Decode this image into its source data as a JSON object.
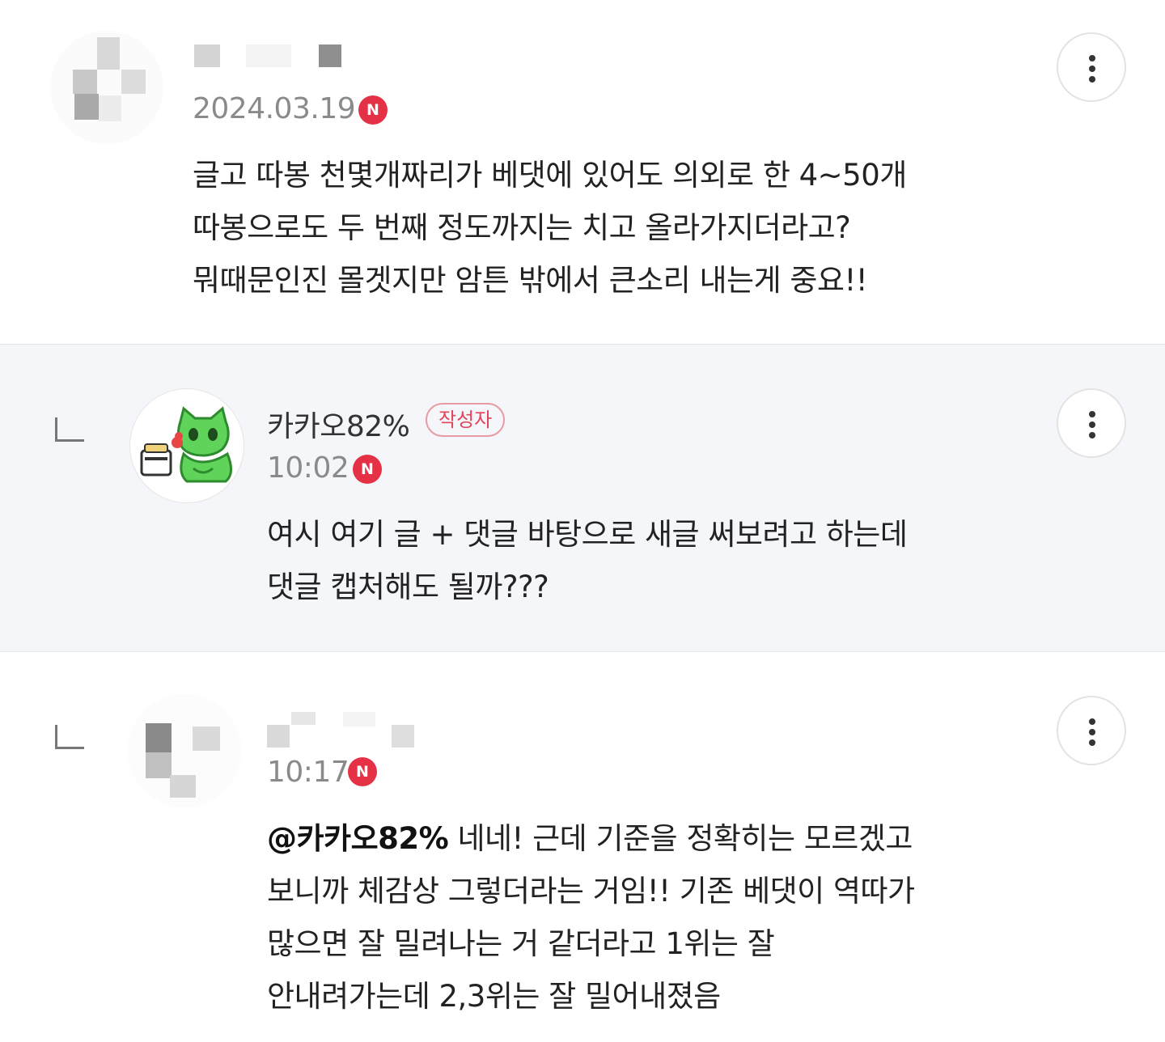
{
  "comments": [
    {
      "name": "",
      "date": "2024.03.19",
      "new_badge": "N",
      "lines": [
        "글고 따봉 천몇개짜리가 베댓에 있어도 의외로 한 4~50개",
        "따봉으로도 두 번째 정도까지는 치고 올라가지더라고?",
        "뭐때문인진 몰겟지만 암튼 밖에서 큰소리 내는게 중요!!"
      ]
    },
    {
      "name": "카카오82%",
      "author_badge": "작성자",
      "date": "10:02",
      "new_badge": "N",
      "lines": [
        "여시 여기 글 + 댓글 바탕으로 새글 써보려고 하는데",
        "댓글 캡처해도 될까???"
      ]
    },
    {
      "name": "",
      "date": "10:17",
      "new_badge": "N",
      "mention": "@카카오82%",
      "lines": [
        " 네네! 근데 기준을 정확히는 모르겠고",
        "보니까 체감상 그렇더라는 거임!! 기존 베댓이 역따가",
        "많으면 잘 밀려나는 거 같더라고 1위는 잘",
        "안내려가는데 2,3위는 잘 밀어내졌음"
      ]
    }
  ],
  "colors": {
    "new_badge": "#e53146",
    "author_badge": "#e0455a",
    "reply_bg": "#f4f6fa"
  },
  "icons": [
    "more-vertical-icon",
    "reply-arrow-icon",
    "new-badge-icon"
  ]
}
